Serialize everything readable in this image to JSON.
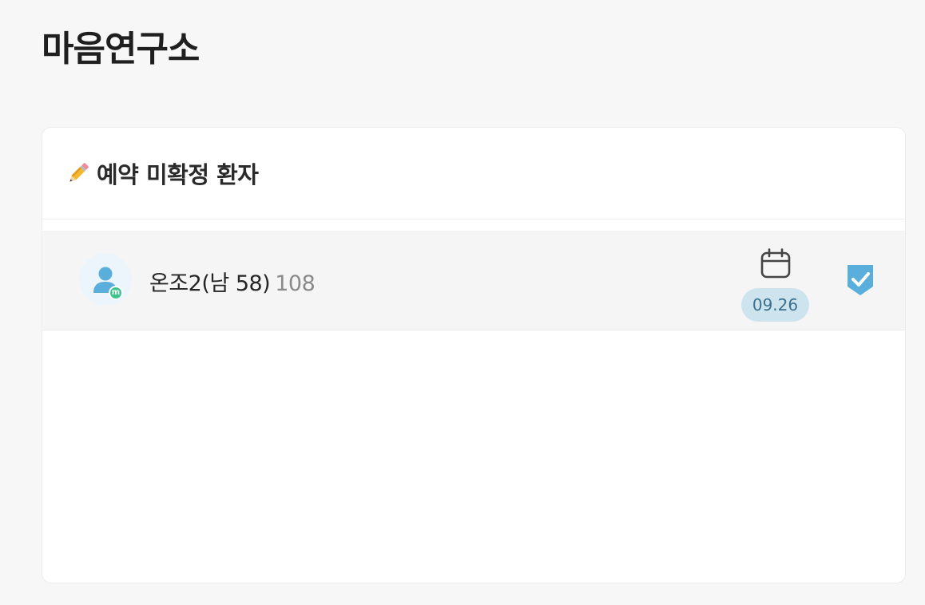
{
  "page": {
    "title": "마음연구소"
  },
  "card": {
    "header": {
      "icon": "pencil-icon",
      "title": "예약 미확정 환자"
    },
    "items": [
      {
        "name_info": "온조2(남 58)",
        "patient_id": "108",
        "avatar_icon": "user-avatar-icon",
        "avatar_badge": "m",
        "calendar_icon": "calendar-icon",
        "date": "09.26",
        "action_icon": "shield-check-icon"
      }
    ]
  },
  "colors": {
    "background": "#f7f7f7",
    "card": "#ffffff",
    "row_background": "#f5f5f5",
    "avatar_blue": "#5aaedc",
    "badge_green": "#3fc48b",
    "date_badge": "#cde4ef",
    "date_text": "#3a6f8d",
    "check_shield": "#5aaedc"
  }
}
